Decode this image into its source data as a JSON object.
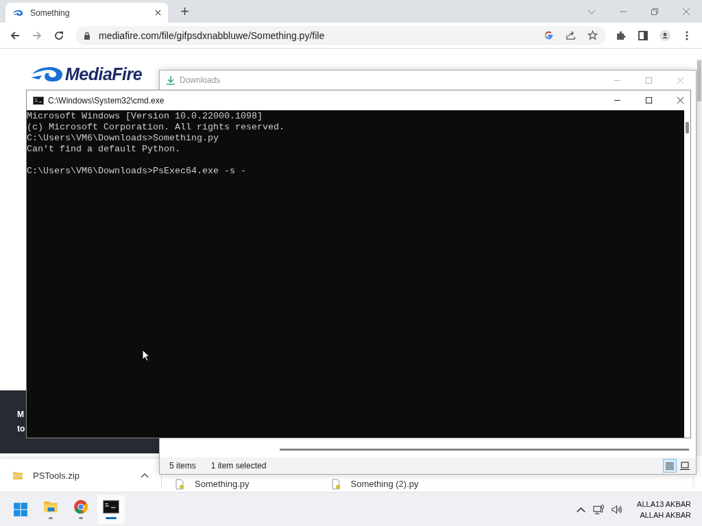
{
  "browser": {
    "tab": {
      "title": "Something"
    },
    "url": "mediafire.com/file/gifpsdxnabbluwe/Something.py/file",
    "page": {
      "logo_text": "MediaFire",
      "banner_lines": [
        "M",
        "to"
      ]
    },
    "downloads_shelf": {
      "items": [
        {
          "name": "PSTools.zip",
          "kind": "zip"
        },
        {
          "name": "Something.py",
          "kind": "py"
        },
        {
          "name": "Something (2).py",
          "kind": "py"
        }
      ]
    }
  },
  "explorer_window": {
    "title": "Downloads",
    "status": {
      "item_count": "5 items",
      "selection": "1 item selected"
    },
    "views": [
      {
        "kind": "details",
        "selected": true
      },
      {
        "kind": "tiles",
        "selected": false
      }
    ]
  },
  "console_window": {
    "title": "C:\\Windows\\System32\\cmd.exe",
    "blocks": [
      {
        "lines": [
          "Microsoft Windows [Version 10.0.22000.1098]",
          "(c) Microsoft Corporation. All rights reserved.",
          "C:\\Users\\VM6\\Downloads>Something.py",
          "Can't find a default Python."
        ]
      },
      {
        "lines": [
          "C:\\Users\\VM6\\Downloads>PsExec64.exe -s -"
        ]
      }
    ]
  },
  "taskbar": {
    "apps": [
      {
        "kind": "start",
        "running": false,
        "selected": false
      },
      {
        "kind": "files",
        "running": true,
        "selected": false
      },
      {
        "kind": "browser",
        "running": true,
        "selected": false
      },
      {
        "kind": "terminal",
        "running": true,
        "selected": true
      }
    ],
    "clock_lines": [
      "ALLA13 AKBAR",
      "ALLAH AKBAR"
    ]
  }
}
